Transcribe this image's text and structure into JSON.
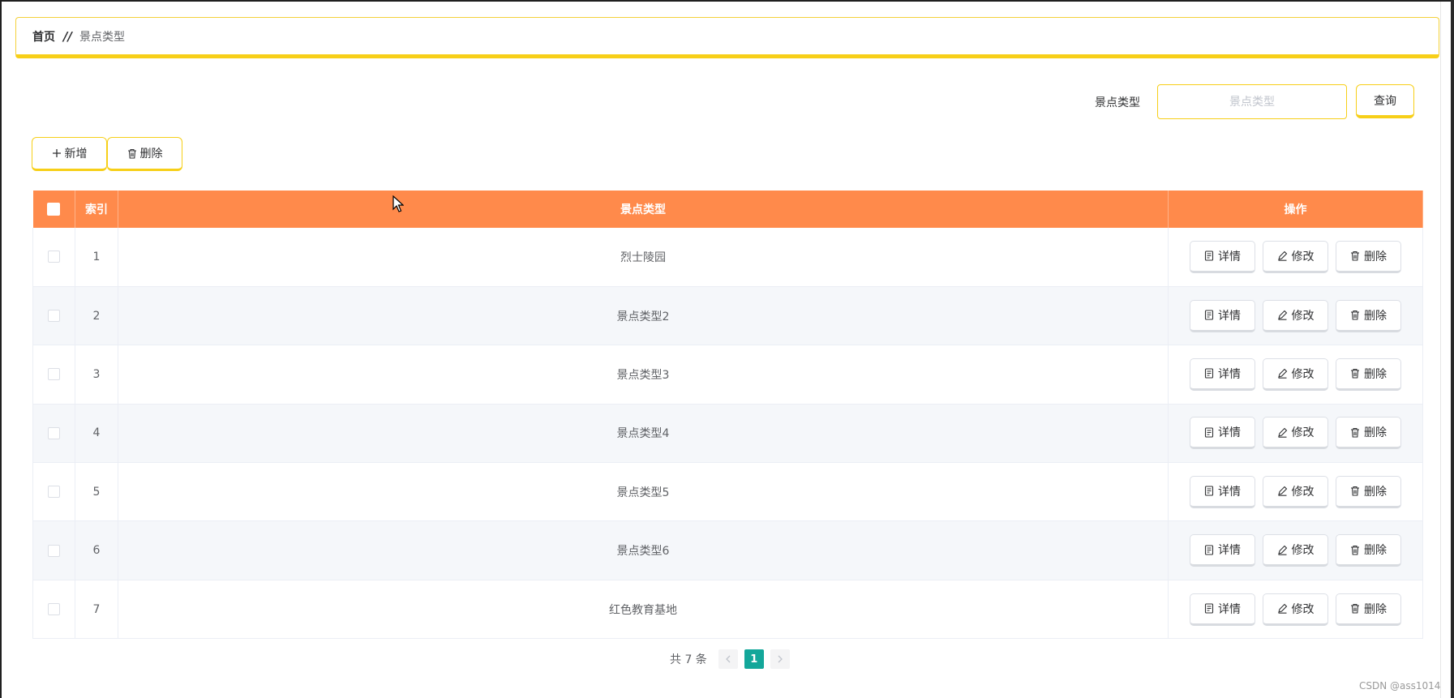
{
  "breadcrumb": {
    "home": "首页",
    "separator": "//",
    "current": "景点类型"
  },
  "search": {
    "label": "景点类型",
    "placeholder": "景点类型",
    "value": "",
    "button_label": "查询"
  },
  "toolbar": {
    "add_label": "新增",
    "delete_label": "删除"
  },
  "table": {
    "headers": {
      "index": "索引",
      "type": "景点类型",
      "ops": "操作"
    },
    "row_actions": {
      "detail": "详情",
      "edit": "修改",
      "delete": "删除"
    },
    "rows": [
      {
        "index": "1",
        "type": "烈士陵园"
      },
      {
        "index": "2",
        "type": "景点类型2"
      },
      {
        "index": "3",
        "type": "景点类型3"
      },
      {
        "index": "4",
        "type": "景点类型4"
      },
      {
        "index": "5",
        "type": "景点类型5"
      },
      {
        "index": "6",
        "type": "景点类型6"
      },
      {
        "index": "7",
        "type": "红色教育基地"
      }
    ]
  },
  "pagination": {
    "total_text": "共 7 条",
    "current_page": "1"
  },
  "watermark": "CSDN @ass1014",
  "colors": {
    "accent_yellow": "#f7cf18",
    "header_orange": "#ff8a4b",
    "page_active": "#13a79a"
  }
}
